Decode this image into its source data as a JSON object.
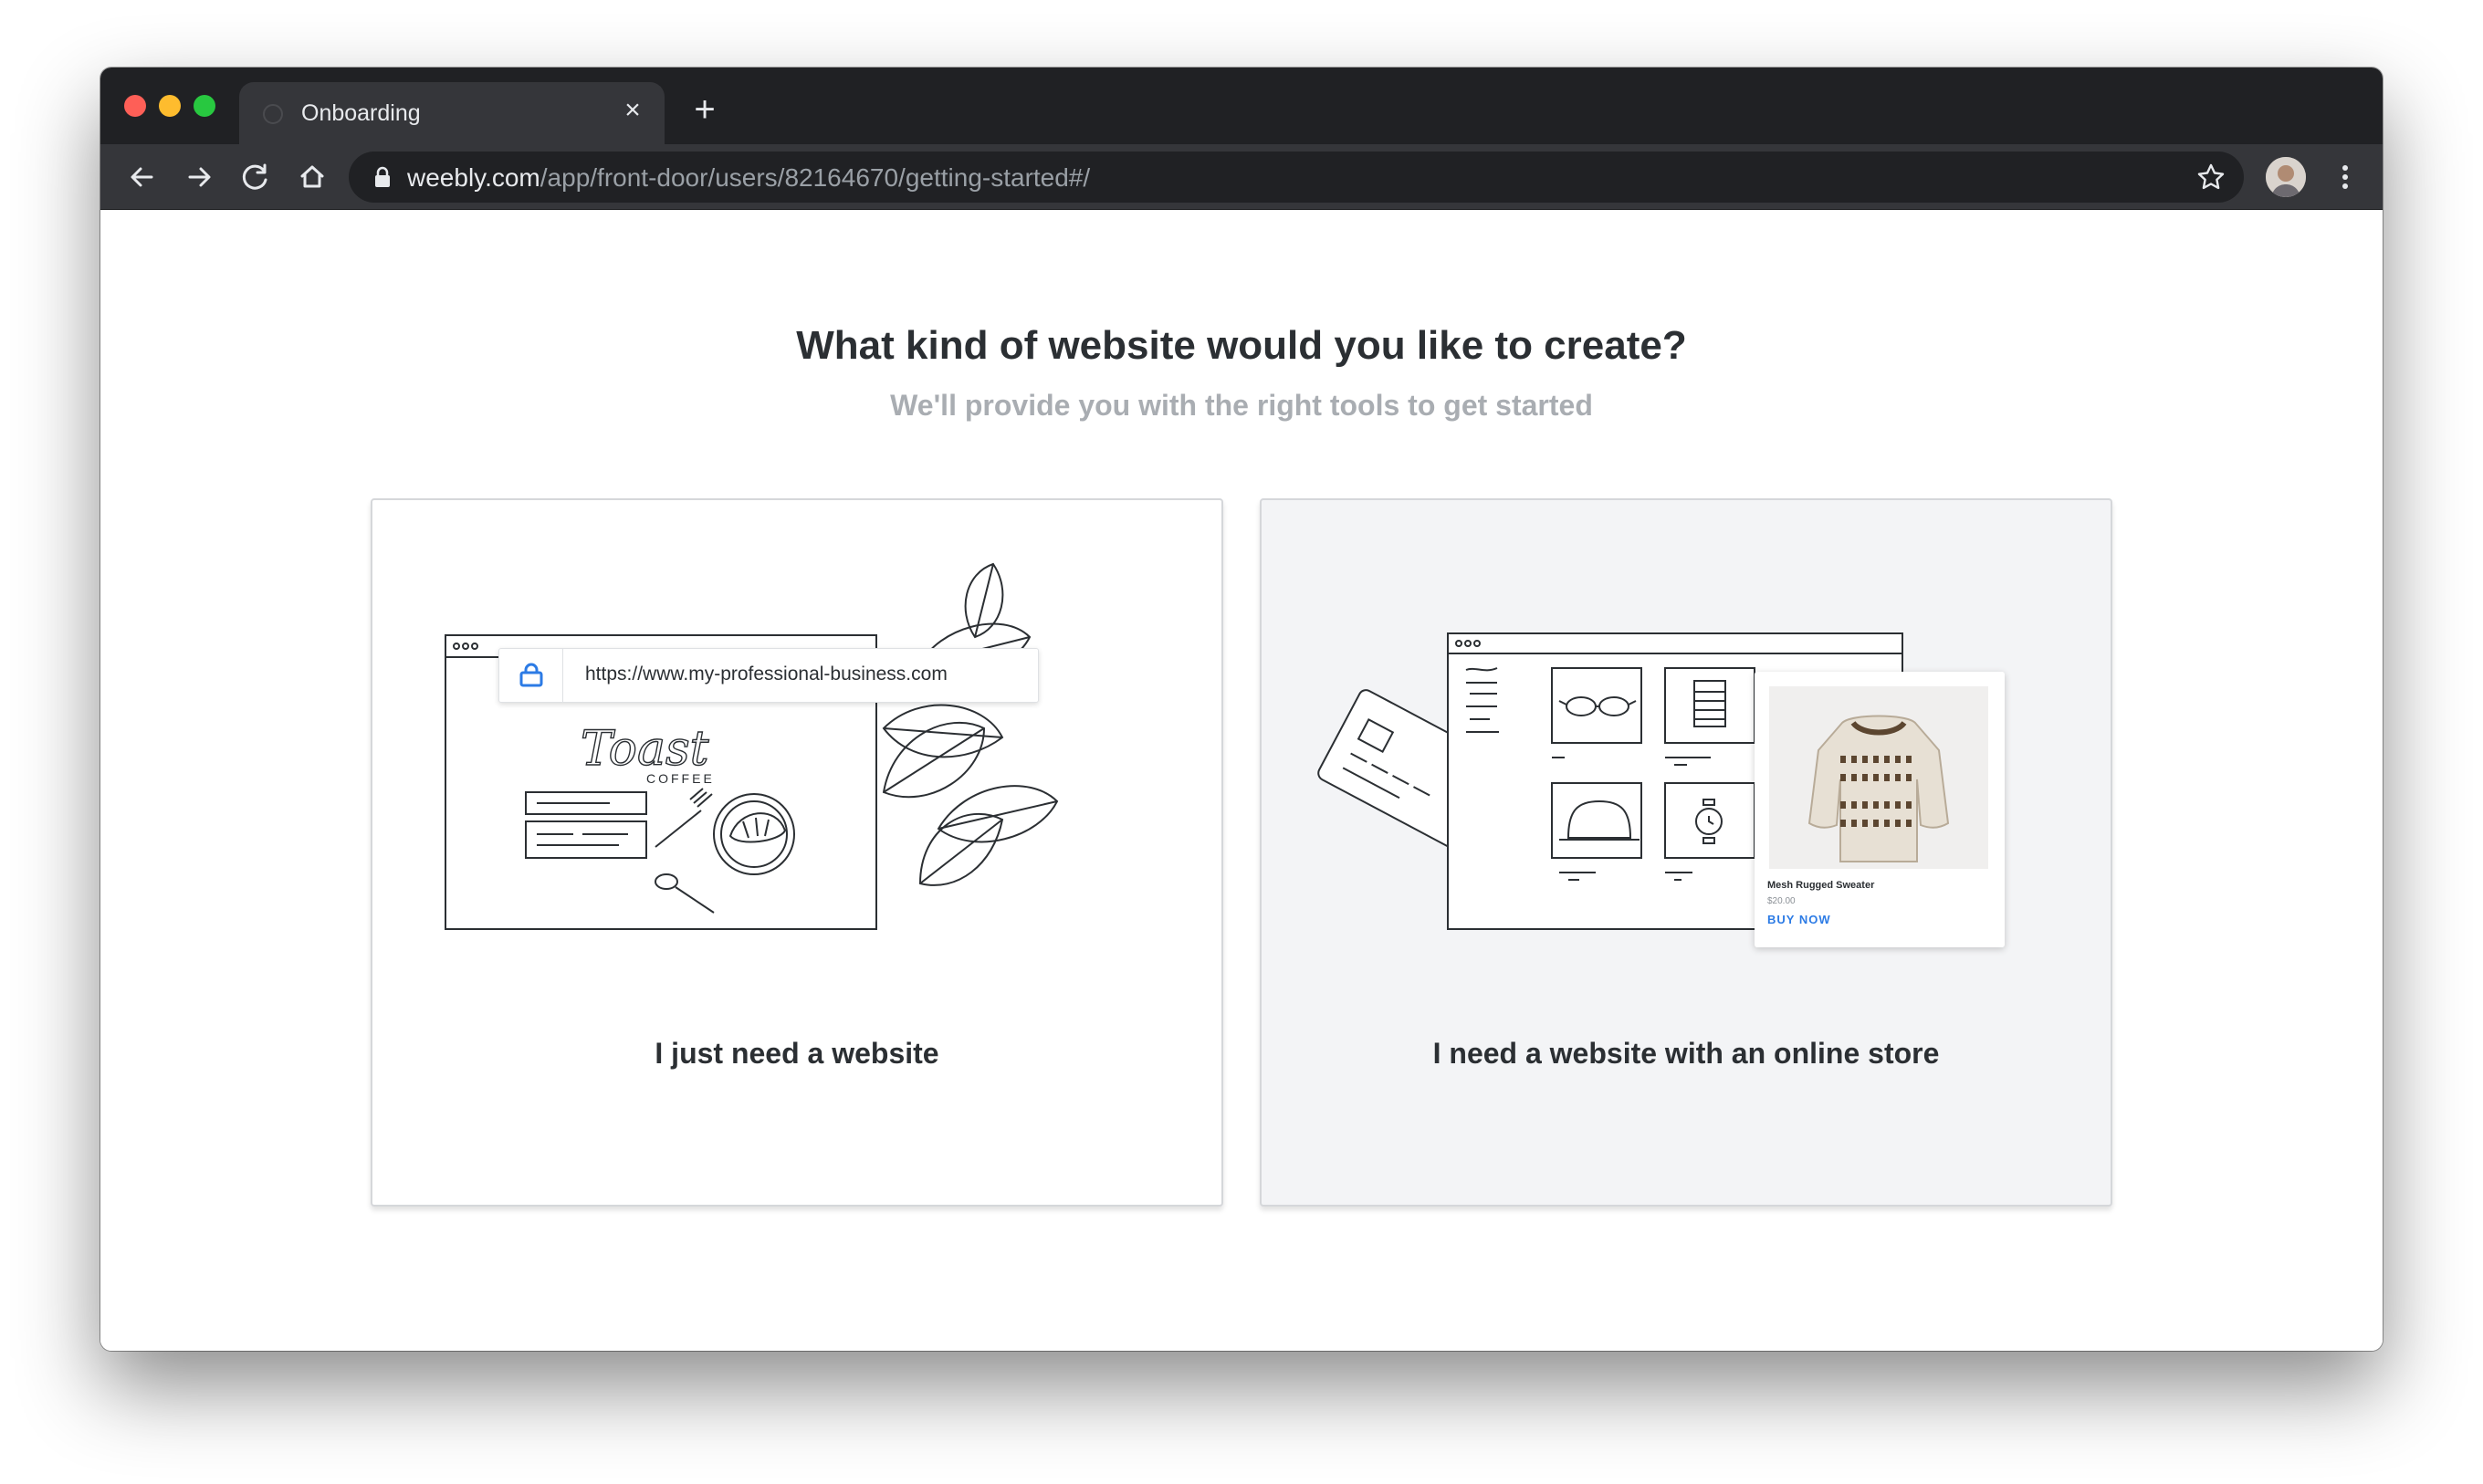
{
  "browser": {
    "tab_title": "Onboarding",
    "tab_close": "×",
    "new_tab": "+",
    "url_host": "weebly.com",
    "url_path": "/app/front-door/users/82164670/getting-started#/"
  },
  "page": {
    "heading": "What kind of website would you like to create?",
    "subheading": "We'll provide you with the right tools to get started"
  },
  "options": [
    {
      "label": "I just need a website",
      "illustration_url": "https://www.my-professional-business.com",
      "illustration_logo": "Toast",
      "illustration_logo_sub": "COFFEE"
    },
    {
      "label": "I need a website with an online store",
      "product_name": "Mesh Rugged Sweater",
      "product_price": "$20.00",
      "product_cta": "BUY NOW"
    }
  ],
  "icons": {
    "back": "arrow-left-icon",
    "forward": "arrow-right-icon",
    "reload": "reload-icon",
    "home": "home-icon",
    "lock": "lock-icon",
    "bookmark": "star-icon",
    "menu": "kebab-menu-icon"
  },
  "colors": {
    "chrome_dark": "#202124",
    "chrome_toolbar": "#35363a",
    "accent_blue": "#2c7be5",
    "heading": "#2b2f33",
    "subheading": "#a9adb2",
    "selected_card_bg": "#f3f4f6"
  }
}
